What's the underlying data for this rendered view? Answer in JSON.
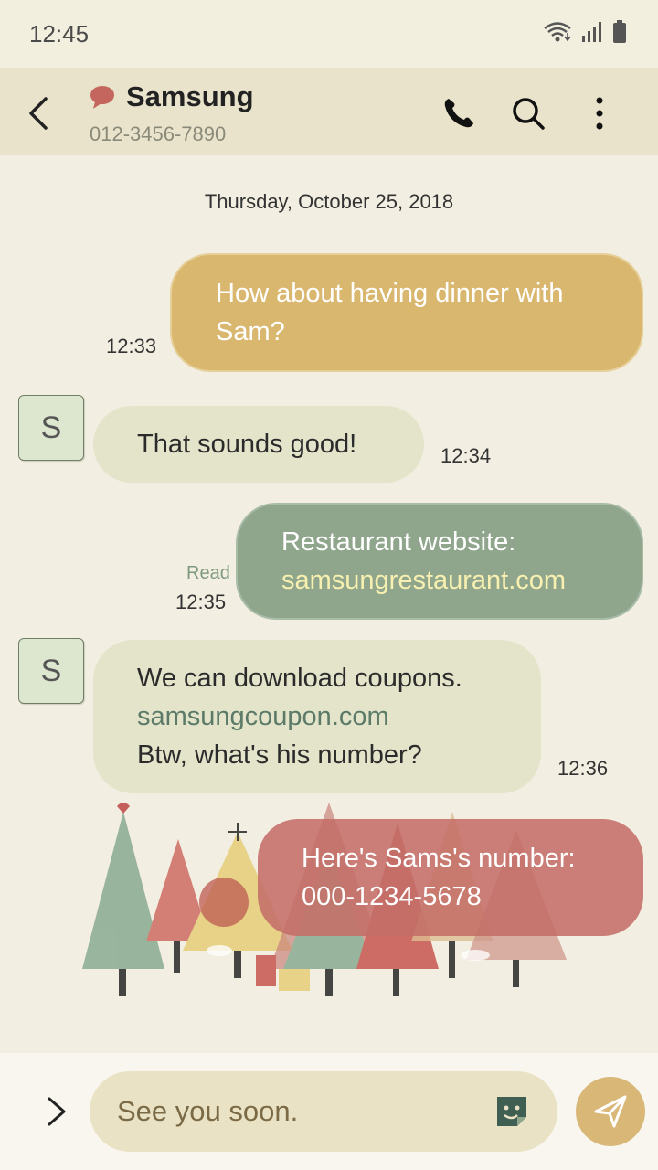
{
  "status_bar": {
    "time": "12:45"
  },
  "header": {
    "contact_name": "Samsung",
    "contact_number": "012-3456-7890"
  },
  "chat": {
    "date": "Thursday, October 25, 2018",
    "messages": [
      {
        "direction": "sent",
        "lines": [
          "How about having dinner with",
          "Sam?"
        ],
        "time": "12:33"
      },
      {
        "direction": "received",
        "avatar": "S",
        "lines": [
          "That sounds good!"
        ],
        "time": "12:34"
      },
      {
        "direction": "sent",
        "lines": [
          "Restaurant website:",
          "samsungrestaurant.com"
        ],
        "time": "12:35",
        "status": "Read"
      },
      {
        "direction": "received",
        "avatar": "S",
        "lines": [
          "We can download coupons.",
          "samsungcoupon.com",
          "Btw, what's his number?"
        ],
        "time": "12:36"
      },
      {
        "direction": "sent",
        "lines": [
          "Here's Sams's number:",
          "000-1234-5678"
        ],
        "time": ""
      }
    ]
  },
  "composer": {
    "text": "See you soon."
  },
  "colors": {
    "header_bg": "#e9e3cb",
    "sent_bubble_gold": "#d9b76f",
    "sent_bubble_green": "#8fa68d",
    "sent_bubble_red": "#c46e68",
    "received_bubble": "#e4e4ca",
    "send_button": "#d9b877"
  },
  "icons": [
    "wifi-icon",
    "signal-icon",
    "battery-icon",
    "back-icon",
    "chat-bubble-icon",
    "phone-icon",
    "search-icon",
    "more-icon",
    "chevron-right-icon",
    "sticker-icon",
    "send-icon"
  ]
}
